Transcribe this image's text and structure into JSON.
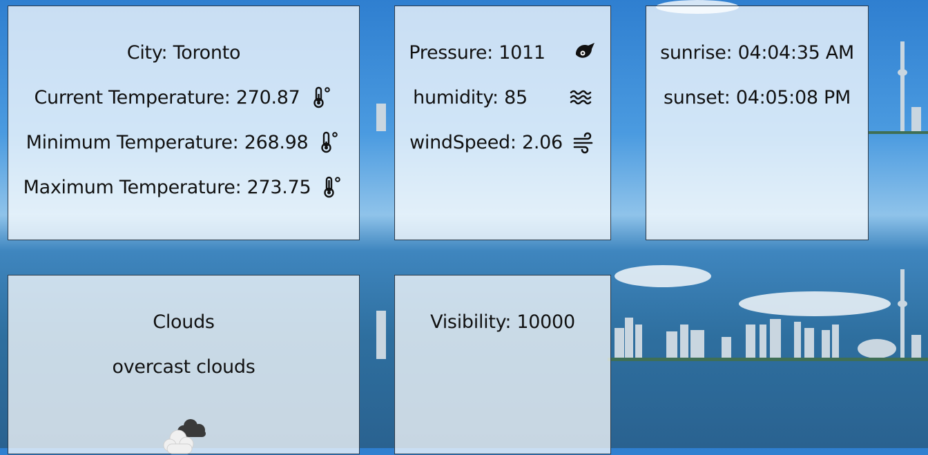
{
  "weather": {
    "city_label": "City: Toronto",
    "current_temp_label": "Current Temperature: 270.87",
    "min_temp_label": "Minimum Temperature: 268.98",
    "max_temp_label": "Maximum Temperature: 273.75",
    "pressure_label": "Pressure: 1011",
    "humidity_label": "humidity: 85",
    "windspeed_label": "windSpeed: 2.06",
    "sunrise_label": "sunrise: 04:04:35 AM",
    "sunset_label": "sunset: 04:05:08 PM",
    "clouds_title": "Clouds",
    "clouds_description": "overcast clouds",
    "visibility_label": "Visibility: 10000"
  },
  "icons": {
    "temperature": "thermometer-icon",
    "pressure": "barometer-icon",
    "humidity": "humidity-waves-icon",
    "wind": "wind-icon",
    "clouds": "overcast-cloud-icon"
  },
  "colors": {
    "card_background": "#ffffffbd",
    "card_border": "#2b3a4a",
    "text": "#111111",
    "sky": "#4b9be0",
    "water": "#2e6f9f"
  }
}
